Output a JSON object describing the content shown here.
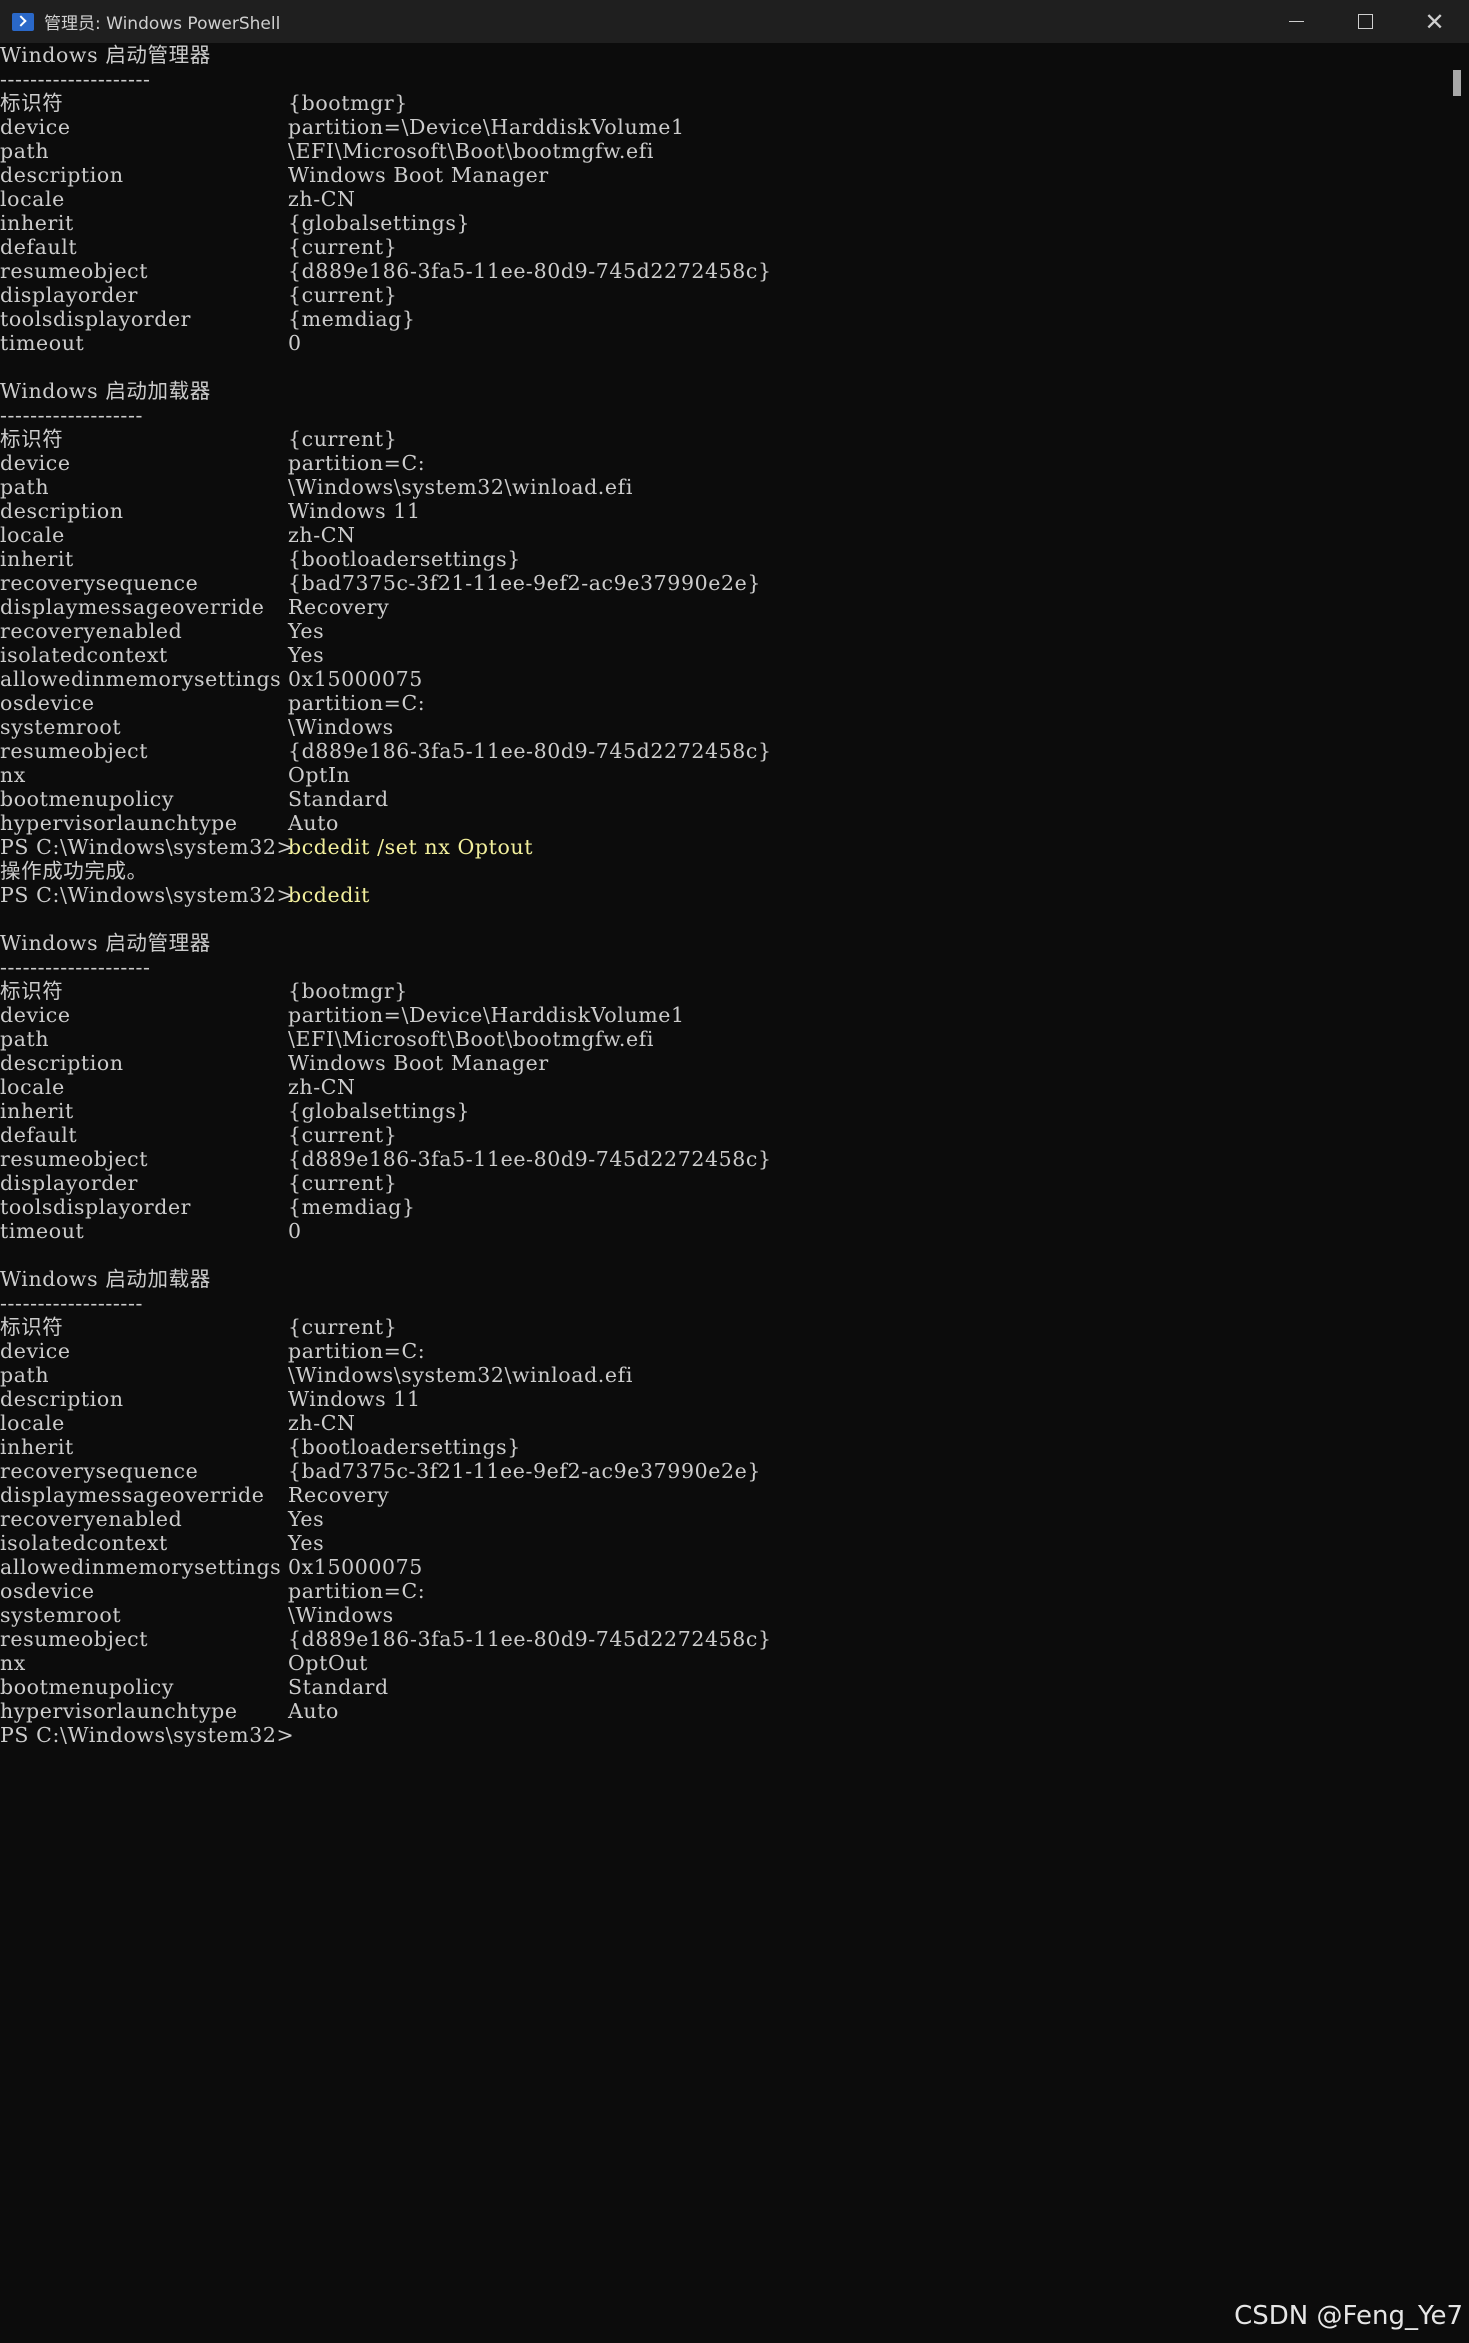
{
  "window": {
    "title": "管理员: Windows PowerShell"
  },
  "console": {
    "lines": [
      {
        "t": "Windows 启动管理器"
      },
      {
        "t": "--------------------"
      },
      {
        "k": "标识符",
        "v": "{bootmgr}"
      },
      {
        "k": "device",
        "v": "partition=\\Device\\HarddiskVolume1"
      },
      {
        "k": "path",
        "v": "\\EFI\\Microsoft\\Boot\\bootmgfw.efi"
      },
      {
        "k": "description",
        "v": "Windows Boot Manager"
      },
      {
        "k": "locale",
        "v": "zh-CN"
      },
      {
        "k": "inherit",
        "v": "{globalsettings}"
      },
      {
        "k": "default",
        "v": "{current}"
      },
      {
        "k": "resumeobject",
        "v": "{d889e186-3fa5-11ee-80d9-745d2272458c}"
      },
      {
        "k": "displayorder",
        "v": "{current}"
      },
      {
        "k": "toolsdisplayorder",
        "v": "{memdiag}"
      },
      {
        "k": "timeout",
        "v": "0"
      },
      {
        "t": ""
      },
      {
        "t": "Windows 启动加载器"
      },
      {
        "t": "-------------------"
      },
      {
        "k": "标识符",
        "v": "{current}"
      },
      {
        "k": "device",
        "v": "partition=C:"
      },
      {
        "k": "path",
        "v": "\\Windows\\system32\\winload.efi"
      },
      {
        "k": "description",
        "v": "Windows 11"
      },
      {
        "k": "locale",
        "v": "zh-CN"
      },
      {
        "k": "inherit",
        "v": "{bootloadersettings}"
      },
      {
        "k": "recoverysequence",
        "v": "{bad7375c-3f21-11ee-9ef2-ac9e37990e2e}"
      },
      {
        "k": "displaymessageoverride",
        "v": "Recovery"
      },
      {
        "k": "recoveryenabled",
        "v": "Yes"
      },
      {
        "k": "isolatedcontext",
        "v": "Yes"
      },
      {
        "k": "allowedinmemorysettings",
        "v": "0x15000075"
      },
      {
        "k": "osdevice",
        "v": "partition=C:"
      },
      {
        "k": "systemroot",
        "v": "\\Windows"
      },
      {
        "k": "resumeobject",
        "v": "{d889e186-3fa5-11ee-80d9-745d2272458c}"
      },
      {
        "k": "nx",
        "v": "OptIn"
      },
      {
        "k": "bootmenupolicy",
        "v": "Standard"
      },
      {
        "k": "hypervisorlaunchtype",
        "v": "Auto"
      },
      {
        "k": "PS C:\\Windows\\system32>",
        "v": "bcdedit /set nx Optout",
        "cmd": true
      },
      {
        "t": "操作成功完成。"
      },
      {
        "k": "PS C:\\Windows\\system32>",
        "v": "bcdedit",
        "cmd": true
      },
      {
        "t": ""
      },
      {
        "t": "Windows 启动管理器"
      },
      {
        "t": "--------------------"
      },
      {
        "k": "标识符",
        "v": "{bootmgr}"
      },
      {
        "k": "device",
        "v": "partition=\\Device\\HarddiskVolume1"
      },
      {
        "k": "path",
        "v": "\\EFI\\Microsoft\\Boot\\bootmgfw.efi"
      },
      {
        "k": "description",
        "v": "Windows Boot Manager"
      },
      {
        "k": "locale",
        "v": "zh-CN"
      },
      {
        "k": "inherit",
        "v": "{globalsettings}"
      },
      {
        "k": "default",
        "v": "{current}"
      },
      {
        "k": "resumeobject",
        "v": "{d889e186-3fa5-11ee-80d9-745d2272458c}"
      },
      {
        "k": "displayorder",
        "v": "{current}"
      },
      {
        "k": "toolsdisplayorder",
        "v": "{memdiag}"
      },
      {
        "k": "timeout",
        "v": "0"
      },
      {
        "t": ""
      },
      {
        "t": "Windows 启动加载器"
      },
      {
        "t": "-------------------"
      },
      {
        "k": "标识符",
        "v": "{current}"
      },
      {
        "k": "device",
        "v": "partition=C:"
      },
      {
        "k": "path",
        "v": "\\Windows\\system32\\winload.efi"
      },
      {
        "k": "description",
        "v": "Windows 11"
      },
      {
        "k": "locale",
        "v": "zh-CN"
      },
      {
        "k": "inherit",
        "v": "{bootloadersettings}"
      },
      {
        "k": "recoverysequence",
        "v": "{bad7375c-3f21-11ee-9ef2-ac9e37990e2e}"
      },
      {
        "k": "displaymessageoverride",
        "v": "Recovery"
      },
      {
        "k": "recoveryenabled",
        "v": "Yes"
      },
      {
        "k": "isolatedcontext",
        "v": "Yes"
      },
      {
        "k": "allowedinmemorysettings",
        "v": "0x15000075"
      },
      {
        "k": "osdevice",
        "v": "partition=C:"
      },
      {
        "k": "systemroot",
        "v": "\\Windows"
      },
      {
        "k": "resumeobject",
        "v": "{d889e186-3fa5-11ee-80d9-745d2272458c}"
      },
      {
        "k": "nx",
        "v": "OptOut"
      },
      {
        "k": "bootmenupolicy",
        "v": "Standard"
      },
      {
        "k": "hypervisorlaunchtype",
        "v": "Auto"
      },
      {
        "t": "PS C:\\Windows\\system32>"
      }
    ]
  },
  "watermark": "CSDN @Feng_Ye7",
  "colors": {
    "background": "#0c0c0c",
    "text": "#cccccc",
    "command": "#f2ef9c",
    "titlebar": "#1f1f1f"
  }
}
